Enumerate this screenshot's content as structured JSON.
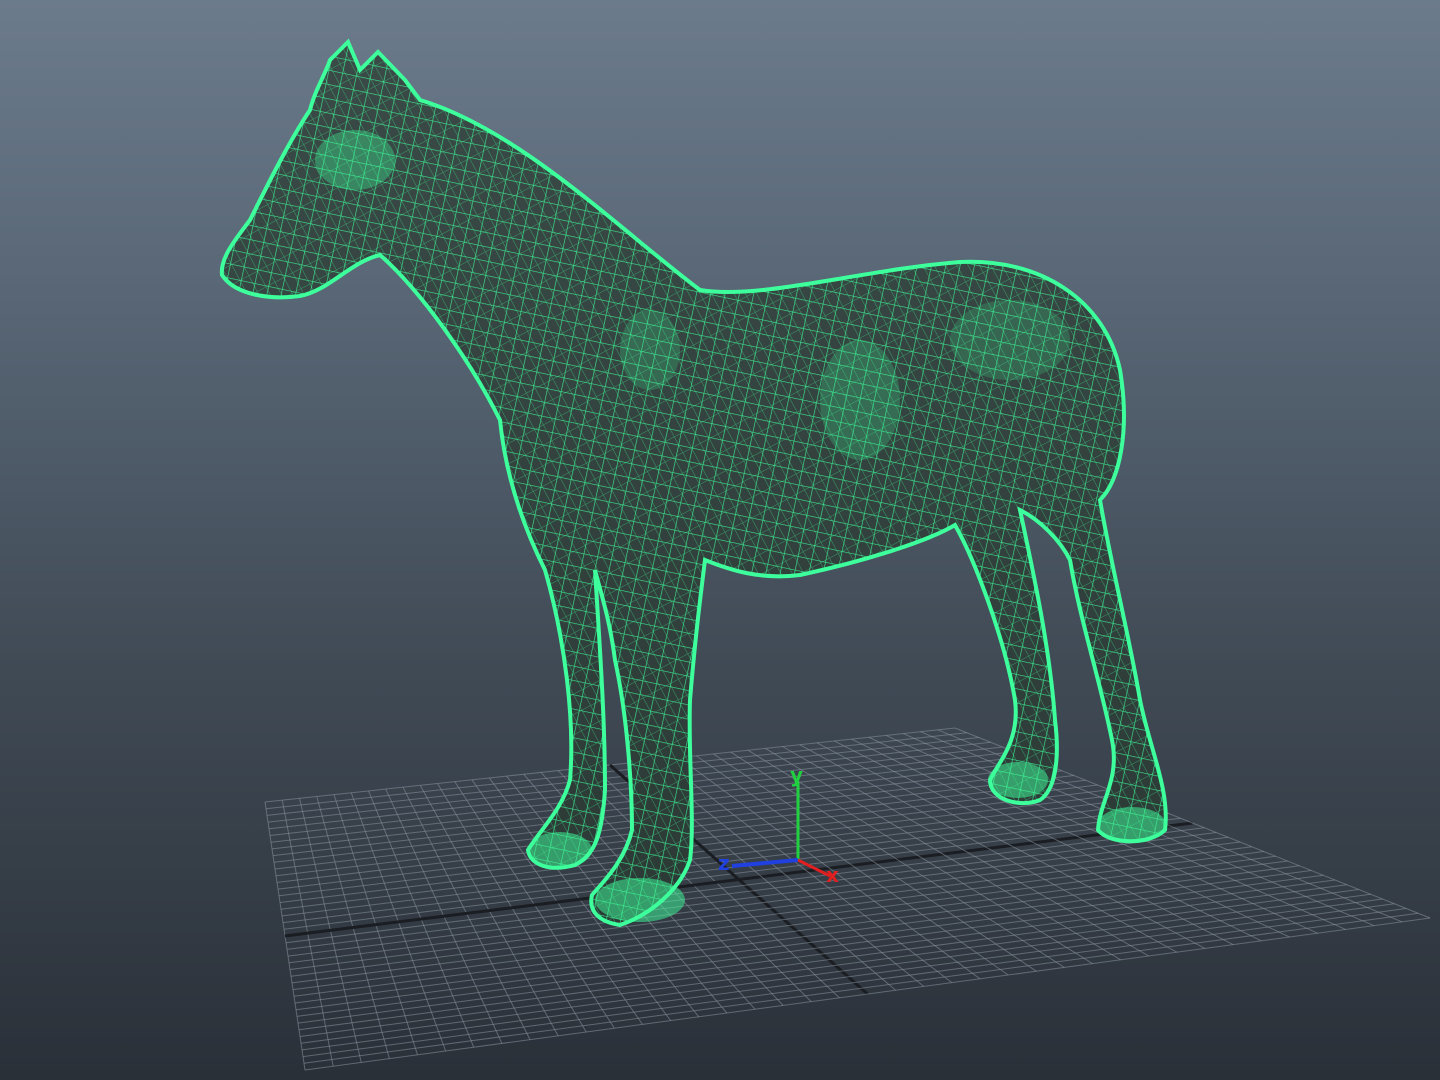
{
  "viewport": {
    "background_top": "#6c7b8c",
    "background_bottom": "#2a3038",
    "wireframe_color": "#3dff9c",
    "grid_color": "#1a1d21"
  },
  "gizmo": {
    "x_label": "x",
    "y_label": "y",
    "z_label": "z",
    "x_color": "#e02020",
    "y_color": "#20d040",
    "z_color": "#2040e0"
  },
  "model": {
    "icon": "horse-wireframe-icon"
  }
}
